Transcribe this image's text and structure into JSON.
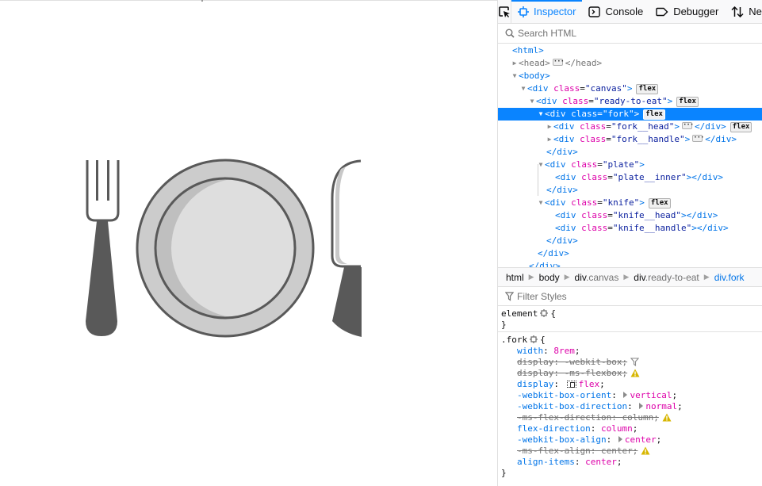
{
  "viewport": {
    "illustration": {
      "items": [
        "fork",
        "plate",
        "knife"
      ],
      "colors": {
        "outline": "#595959",
        "rim": "#cccccc",
        "plate_inner": "#dedede",
        "plate_shadow": "#bfbfbf",
        "blade": "#ffffff",
        "blade_edge": "#c8c8c8",
        "handle": "#595959"
      }
    }
  },
  "devtools": {
    "toolbar": {
      "pick_icon": "element-picker-icon",
      "tabs": [
        {
          "label": "Inspector",
          "icon": "inspector-icon",
          "active": true
        },
        {
          "label": "Console",
          "icon": "console-icon",
          "active": false
        },
        {
          "label": "Debugger",
          "icon": "debugger-icon",
          "active": false
        },
        {
          "label": "Ne",
          "icon": "network-icon",
          "active": false
        }
      ]
    },
    "search": {
      "placeholder": "Search HTML",
      "value": ""
    },
    "markup": {
      "html_open": "<html>",
      "head_open": "<head>",
      "head_close": "</head>",
      "body_open": "<body>",
      "div": "<div",
      "div_close": "</div>",
      "class_attr": "class",
      "eq": "=",
      "gt": ">",
      "badge_flex": "flex",
      "classes": {
        "canvas": "\"canvas\"",
        "ready_to_eat": "\"ready-to-eat\"",
        "fork": "\"fork\"",
        "fork_head": "\"fork__head\"",
        "fork_handle": "\"fork__handle\"",
        "plate": "\"plate\"",
        "plate_inner": "\"plate__inner\"",
        "knife": "\"knife\"",
        "knife_head": "\"knife__head\"",
        "knife_handle": "\"knife__handle\""
      },
      "selected_node": "div.fork"
    },
    "breadcrumbs": [
      {
        "tag": "html",
        "cls": ""
      },
      {
        "tag": "body",
        "cls": ""
      },
      {
        "tag": "div",
        "cls": ".canvas"
      },
      {
        "tag": "div",
        "cls": ".ready-to-eat"
      },
      {
        "tag": "div",
        "cls": ".fork",
        "current": true
      }
    ],
    "filter": {
      "placeholder": "Filter Styles",
      "value": ""
    },
    "rules": {
      "element": {
        "selector": "element",
        "open": "{",
        "close": "}"
      },
      "fork": {
        "selector": ".fork",
        "open": "{",
        "close": "}",
        "declarations": [
          {
            "name": "width",
            "value": "8rem",
            "struck": false
          },
          {
            "name": "display",
            "value": "-webkit-box",
            "struck": true,
            "marker": "filter-icon"
          },
          {
            "name": "display",
            "value": "-ms-flexbox",
            "struck": true,
            "marker": "warning-icon"
          },
          {
            "name": "display",
            "value": "flex",
            "struck": false,
            "marker_before": "flexbox-highlighter-icon"
          },
          {
            "name": "-webkit-box-orient",
            "value": "vertical",
            "struck": false,
            "expander": true
          },
          {
            "name": "-webkit-box-direction",
            "value": "normal",
            "struck": false,
            "expander": true
          },
          {
            "name": "-ms-flex-direction",
            "value": "column",
            "struck": true,
            "marker": "warning-icon"
          },
          {
            "name": "flex-direction",
            "value": "column",
            "struck": false
          },
          {
            "name": "-webkit-box-align",
            "value": "center",
            "struck": false,
            "expander": true
          },
          {
            "name": "-ms-flex-align",
            "value": "center",
            "struck": true,
            "marker": "warning-icon"
          },
          {
            "name": "align-items",
            "value": "center",
            "struck": false
          }
        ]
      }
    }
  }
}
